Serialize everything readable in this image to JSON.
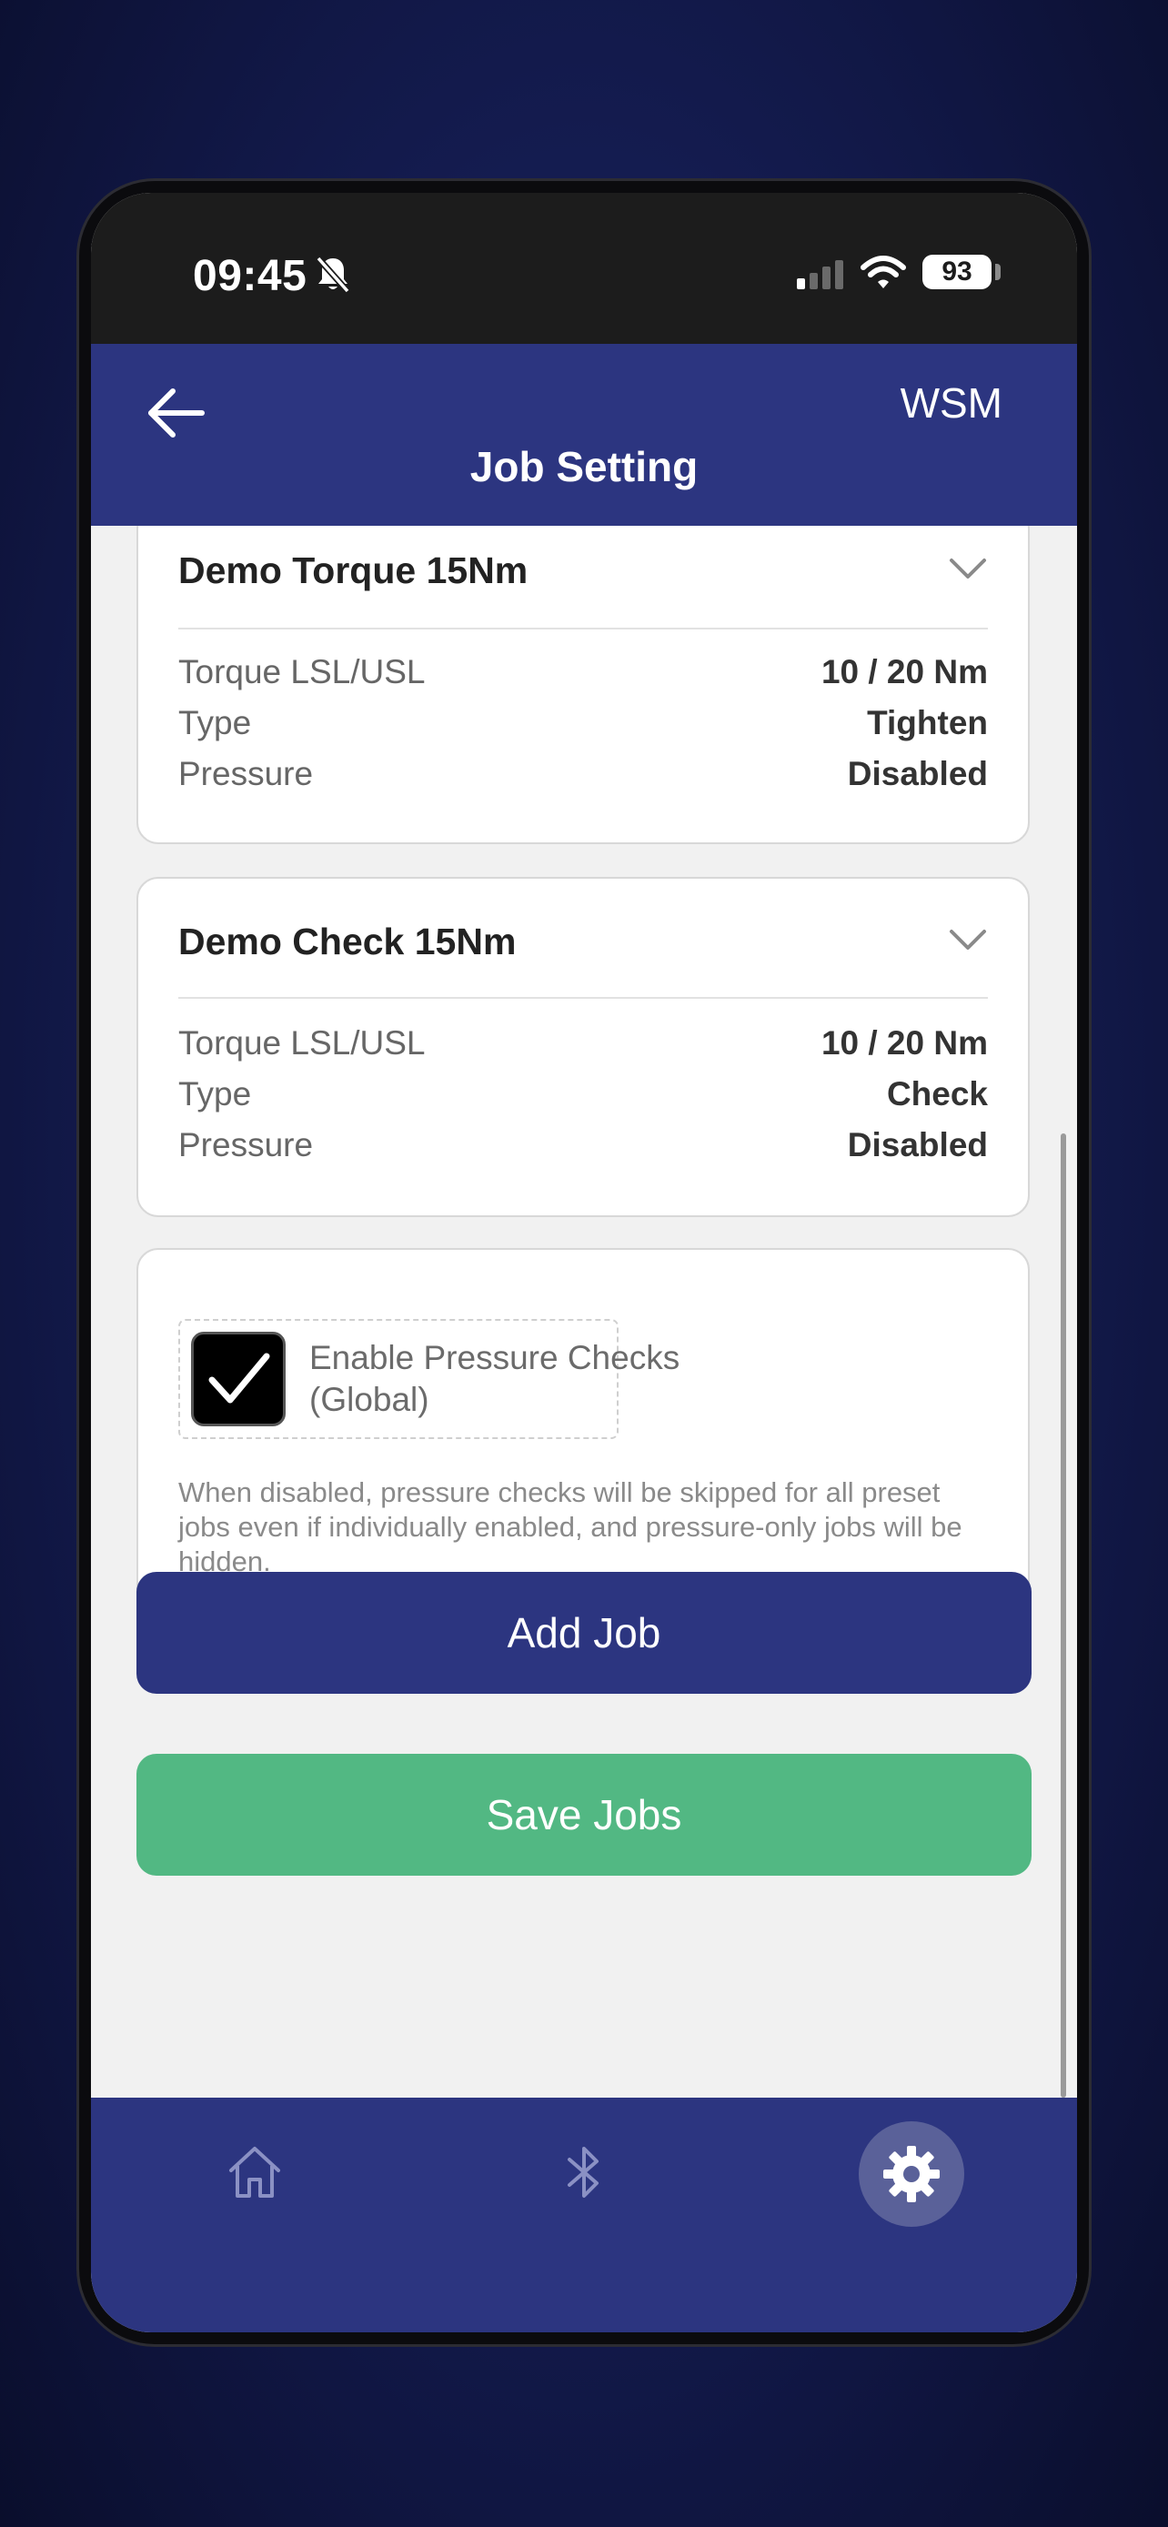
{
  "status_bar": {
    "time": "09:45",
    "battery": "93"
  },
  "header": {
    "title": "Job Setting",
    "right_label": "WSM"
  },
  "jobs": [
    {
      "name": "Demo Torque 15Nm",
      "rows": [
        {
          "label": "Torque LSL/USL",
          "value": "10 / 20 Nm"
        },
        {
          "label": "Type",
          "value": "Tighten"
        },
        {
          "label": "Pressure",
          "value": "Disabled"
        }
      ]
    },
    {
      "name": "Demo Check 15Nm",
      "rows": [
        {
          "label": "Torque LSL/USL",
          "value": "10 / 20 Nm"
        },
        {
          "label": "Type",
          "value": "Check"
        },
        {
          "label": "Pressure",
          "value": "Disabled"
        }
      ]
    }
  ],
  "global_pressure": {
    "checked": true,
    "label": "Enable Pressure Checks (Global)",
    "help": "When disabled, pressure checks will be skipped for all preset jobs even if individually enabled, and pressure-only jobs will be hidden."
  },
  "buttons": {
    "add": "Add Job",
    "save": "Save Jobs"
  },
  "tabs": [
    {
      "icon": "home-icon",
      "active": false
    },
    {
      "icon": "bluetooth-icon",
      "active": false
    },
    {
      "icon": "gear-icon",
      "active": true
    }
  ],
  "colors": {
    "header_bg": "#2c3580",
    "save_button": "#52b883",
    "add_button": "#2c3580",
    "page_bg": "#f1f1f1"
  }
}
